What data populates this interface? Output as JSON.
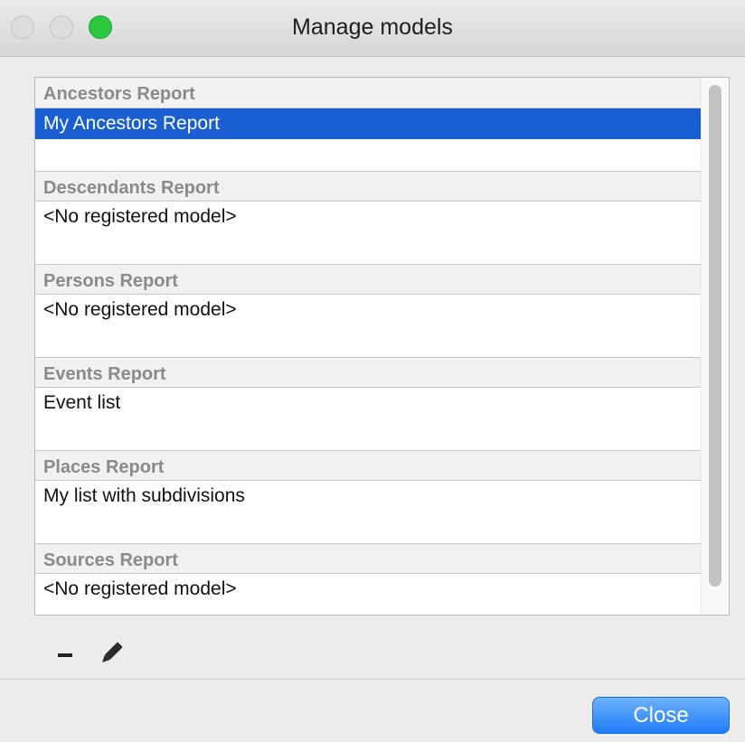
{
  "window": {
    "title": "Manage models"
  },
  "groups": [
    {
      "header": "Ancestors Report",
      "items": [
        {
          "label": "My Ancestors Report",
          "selected": true
        }
      ]
    },
    {
      "header": "Descendants Report",
      "items": [
        {
          "label": "<No registered model>",
          "selected": false
        }
      ]
    },
    {
      "header": "Persons Report",
      "items": [
        {
          "label": "<No registered model>",
          "selected": false
        }
      ]
    },
    {
      "header": "Events Report",
      "items": [
        {
          "label": "Event list",
          "selected": false
        }
      ]
    },
    {
      "header": "Places Report",
      "items": [
        {
          "label": "My list with subdivisions",
          "selected": false
        }
      ]
    },
    {
      "header": "Sources Report",
      "items": [
        {
          "label": "<No registered model>",
          "selected": false
        }
      ]
    }
  ],
  "toolbar": {
    "remove_icon": "minus-icon",
    "edit_icon": "pencil-icon"
  },
  "footer": {
    "close_label": "Close"
  },
  "colors": {
    "selection": "#1a5fd1",
    "accent_button": "#1f7cf5",
    "header_text": "#8a8a8a"
  }
}
